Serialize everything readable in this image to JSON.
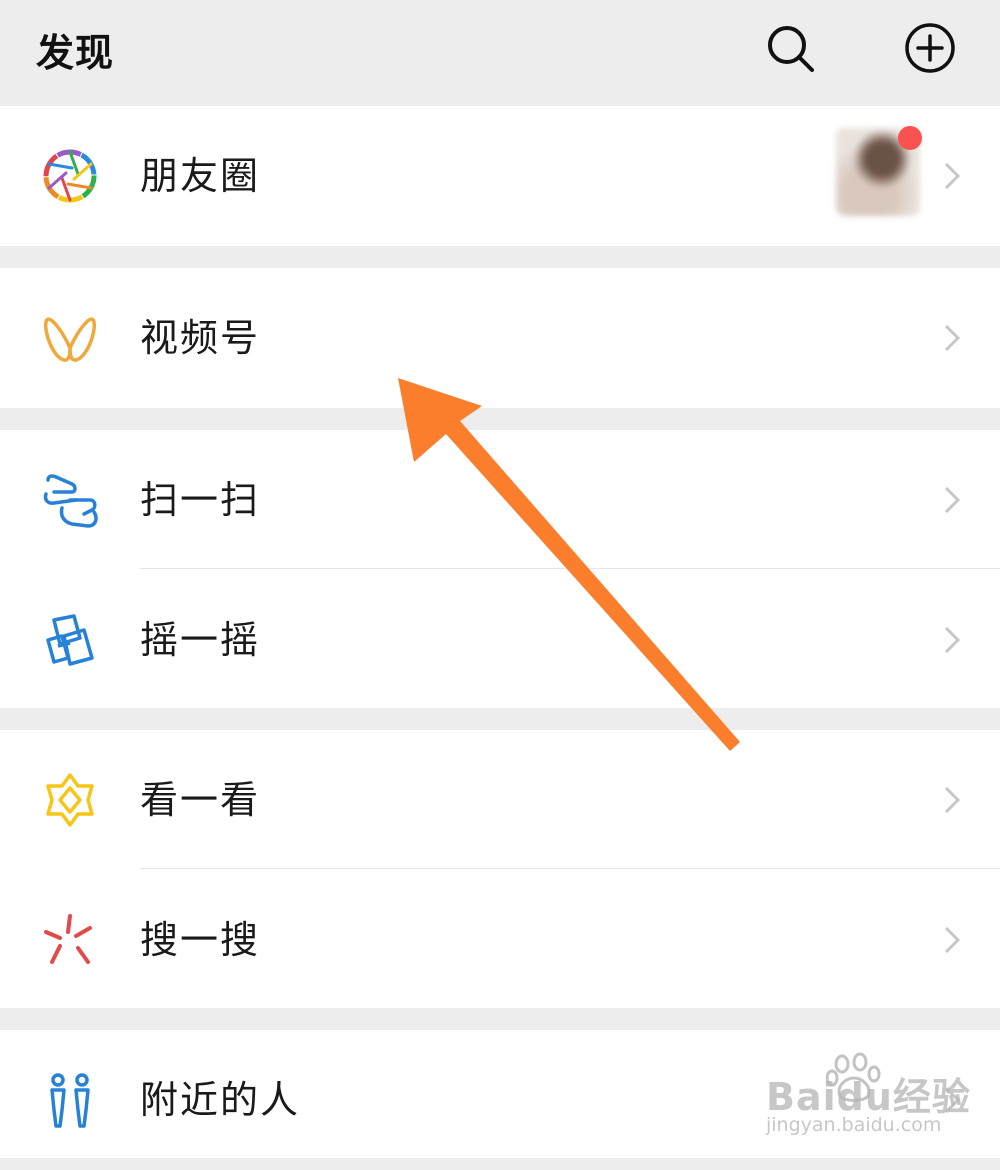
{
  "header": {
    "title": "发现",
    "search_icon": "search-icon",
    "add_icon": "plus-circle-icon"
  },
  "items": [
    {
      "label": "朋友圈",
      "icon": "moments-aperture-icon",
      "has_avatar_badge": true
    },
    {
      "label": "视频号",
      "icon": "channels-icon"
    },
    {
      "label": "扫一扫",
      "icon": "scan-icon"
    },
    {
      "label": "摇一摇",
      "icon": "shake-icon"
    },
    {
      "label": "看一看",
      "icon": "top-stories-icon"
    },
    {
      "label": "搜一搜",
      "icon": "search-sparkle-icon"
    },
    {
      "label": "附近的人",
      "icon": "people-nearby-icon"
    }
  ],
  "annotation": {
    "type": "arrow",
    "color": "#fa7e2c",
    "points_to": "视频号"
  },
  "watermark": {
    "brand": "Baidu经验",
    "sub": "jingyan.baidu.com"
  },
  "colors": {
    "background": "#ededed",
    "row": "#ffffff",
    "badge": "#fa5151",
    "channels": "#f0a73b",
    "scan": "#2782d7",
    "top_stories": "#f5c518",
    "search": "#e24a4a",
    "nearby": "#2782d7"
  }
}
